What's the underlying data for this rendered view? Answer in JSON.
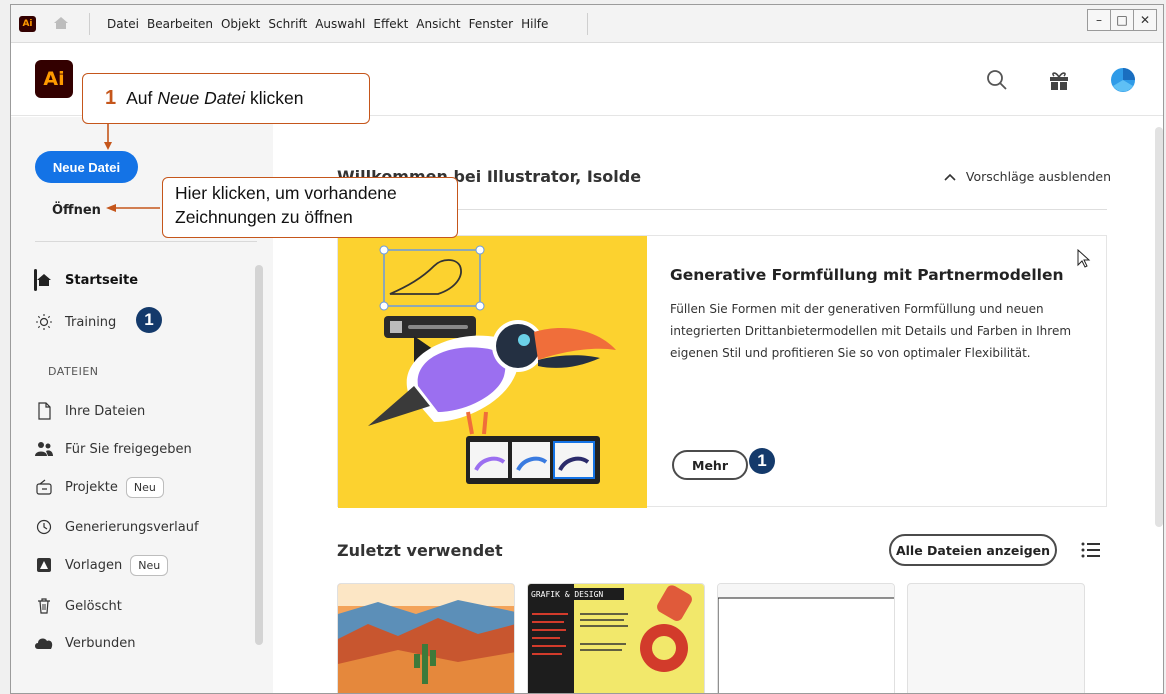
{
  "menubar": {
    "logo_text": "Ai",
    "items": [
      "Datei",
      "Bearbeiten",
      "Objekt",
      "Schrift",
      "Auswahl",
      "Effekt",
      "Ansicht",
      "Fenster",
      "Hilfe"
    ],
    "window_controls": [
      "–",
      "□",
      "✕"
    ]
  },
  "header": {
    "logo_text": "Ai",
    "icons": [
      "search-icon",
      "gift-icon",
      "avatar"
    ]
  },
  "sidebar": {
    "new_file": "Neue Datei",
    "open": "Öffnen",
    "items": [
      {
        "label": "Startseite",
        "icon": "home-icon"
      },
      {
        "label": "Training",
        "icon": "lightbulb-icon"
      }
    ],
    "section_label": "DATEIEN",
    "file_items": [
      {
        "label": "Ihre Dateien",
        "icon": "file-icon"
      },
      {
        "label": "Für Sie freigegeben",
        "icon": "people-icon"
      },
      {
        "label": "Projekte",
        "icon": "projects-icon",
        "pill": "Neu"
      },
      {
        "label": "Generierungsverlauf",
        "icon": "history-icon"
      },
      {
        "label": "Vorlagen",
        "icon": "templates-icon",
        "pill": "Neu"
      },
      {
        "label": "Gelöscht",
        "icon": "trash-icon"
      },
      {
        "label": "Verbunden",
        "icon": "cloud-icon"
      }
    ]
  },
  "main": {
    "welcome": "Willkommen bei Illustrator, Isolde",
    "hide_suggestions": "Vorschläge ausblenden",
    "card": {
      "title": "Generative Formfüllung mit Partnermodellen",
      "description": "Füllen Sie Formen mit der generativen Formfüllung und neuen integrierten Drittanbietermodellen mit Details und Farben in Ihrem eigenen Stil und profitieren Sie so von optimaler Flexibilität.",
      "more_button": "Mehr"
    },
    "recent": {
      "title": "Zuletzt verwendet",
      "all_files_button": "Alle Dateien anzeigen",
      "thumb2_title": "GRAFIK & DESIGN"
    }
  },
  "badges": {
    "number": "1"
  },
  "callouts": {
    "c1_number": "1",
    "c1_text_pre": "Auf ",
    "c1_text_em": "Neue Datei",
    "c1_text_post": " klicken",
    "c2_line1": "Hier klicken, um vorhandene",
    "c2_line2": "Zeichnungen zu öffnen"
  },
  "colors": {
    "accent": "#1473e6",
    "callout_border": "#c5561b",
    "badge": "#143a6b",
    "card_bg": "#fcd22f"
  }
}
